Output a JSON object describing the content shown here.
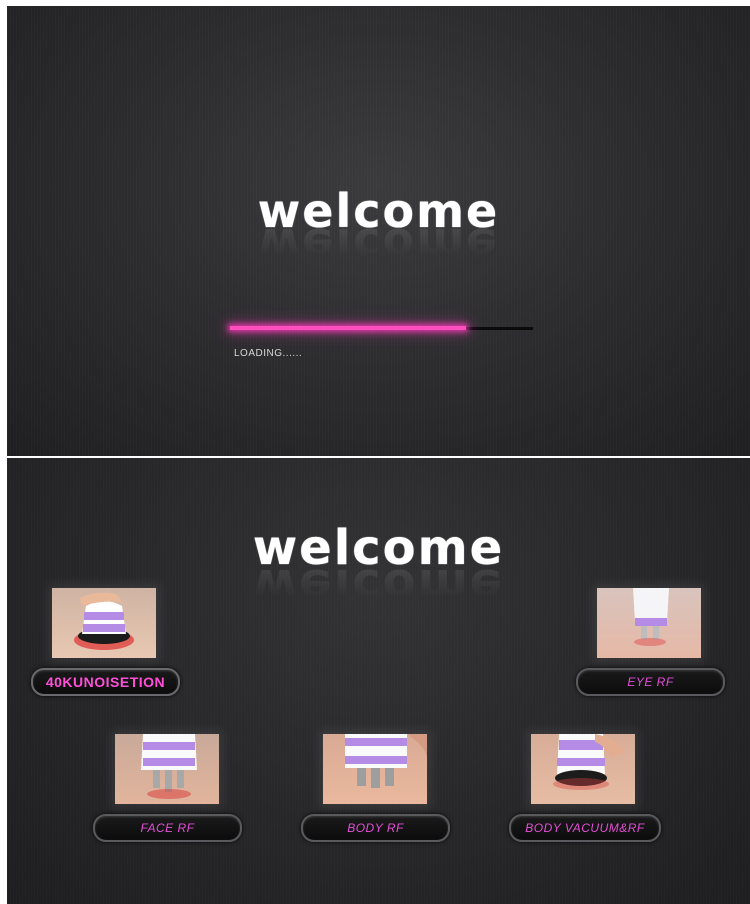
{
  "loading_screen": {
    "welcome_text": "welcome",
    "progress": 0.78,
    "progress_color": "#ff4fbf",
    "loading_label": "LOADING......"
  },
  "menu_screen": {
    "welcome_text": "welcome",
    "label_color": "#e44fd6",
    "tiles": [
      {
        "label": "40KUNOISETION",
        "icon": "ultrasonic-cavitation-handpiece"
      },
      {
        "label": "EYE  RF",
        "icon": "eye-rf-handpiece"
      },
      {
        "label": "FACE  RF",
        "icon": "face-rf-handpiece"
      },
      {
        "label": "BODY  RF",
        "icon": "body-rf-handpiece"
      },
      {
        "label": "BODY  VACUUM&RF",
        "icon": "body-vacuum-rf-handpiece"
      }
    ]
  }
}
